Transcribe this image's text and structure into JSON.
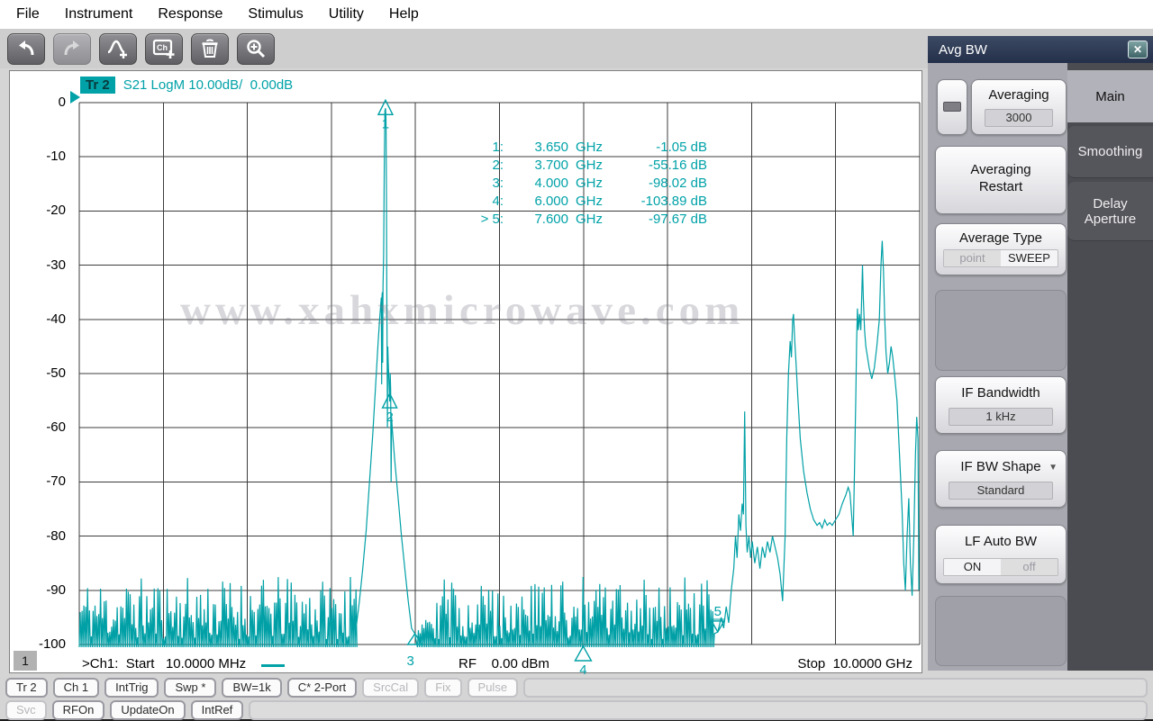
{
  "menu": {
    "items": [
      "File",
      "Instrument",
      "Response",
      "Stimulus",
      "Utility",
      "Help"
    ]
  },
  "toolbar": {
    "buttons": [
      {
        "icon": "undo-icon",
        "disabled": false
      },
      {
        "icon": "redo-icon",
        "disabled": true
      },
      {
        "icon": "add-trace-icon",
        "disabled": false
      },
      {
        "icon": "add-channel-icon",
        "disabled": false
      },
      {
        "icon": "delete-trash-icon",
        "disabled": false
      },
      {
        "icon": "zoom-in-icon",
        "disabled": false
      }
    ]
  },
  "plot": {
    "trace_badge": "Tr 2",
    "trace_title": "S21 LogM 10.00dB/  0.00dB",
    "channel_badge": "1",
    "start_label": ">Ch1:  Start   10.0000 MHz",
    "rf_label": "RF    0.00 dBm",
    "stop_label": "Stop  10.0000 GHz",
    "readout": [
      {
        "label": "1:",
        "freq": "3.650",
        "unit": "GHz",
        "value": "-1.05 dB"
      },
      {
        "label": "2:",
        "freq": "3.700",
        "unit": "GHz",
        "value": "-55.16 dB"
      },
      {
        "label": "3:",
        "freq": "4.000",
        "unit": "GHz",
        "value": "-98.02 dB"
      },
      {
        "label": "4:",
        "freq": "6.000",
        "unit": "GHz",
        "value": "-103.89 dB"
      },
      {
        "label": "> 5:",
        "freq": "7.600",
        "unit": "GHz",
        "value": "-97.67 dB"
      }
    ]
  },
  "chart_data": {
    "type": "line",
    "title": "S21 LogM 10.00dB/ 0.00dB",
    "trace_name": "Tr 2",
    "format": "Log magnitude, 10 dB/div, ref 0 dB",
    "x_unit": "GHz",
    "y_unit": "dB",
    "x_range": [
      0.01,
      10.0
    ],
    "ylim": [
      -100,
      0
    ],
    "x_divisions": 10,
    "y_ticks": [
      0,
      -10,
      -20,
      -30,
      -40,
      -50,
      -60,
      -70,
      -80,
      -90,
      -100
    ],
    "grid": true,
    "markers": [
      {
        "id": "1",
        "f": 3.65,
        "db": -1.05,
        "style": "up"
      },
      {
        "id": "2",
        "f": 3.7,
        "db": -55.16,
        "style": "up"
      },
      {
        "id": "3",
        "f": 4.0,
        "db": -98.02,
        "style": "pin-axis"
      },
      {
        "id": "4",
        "f": 6.0,
        "db": -103.89,
        "style": "pin-below"
      },
      {
        "id": "5",
        "f": 7.6,
        "db": -97.67,
        "style": "down-label-above"
      }
    ],
    "segments": [
      {
        "type": "noise",
        "from": 0.01,
        "to": 3.3,
        "step": 0.022,
        "floor": -100.8,
        "top_lo": -99,
        "top_hi": -87.5,
        "seed": 11
      },
      {
        "type": "points",
        "pts": [
          [
            3.3,
            -97
          ],
          [
            3.34,
            -92
          ],
          [
            3.38,
            -86
          ],
          [
            3.42,
            -79
          ],
          [
            3.46,
            -70
          ],
          [
            3.5,
            -61
          ],
          [
            3.53,
            -53
          ],
          [
            3.56,
            -45
          ],
          [
            3.58,
            -40
          ],
          [
            3.595,
            -37
          ],
          [
            3.6,
            -36
          ],
          [
            3.604,
            -52
          ],
          [
            3.608,
            -36
          ],
          [
            3.612,
            -35
          ],
          [
            3.616,
            -48
          ],
          [
            3.62,
            -34
          ],
          [
            3.628,
            -28
          ],
          [
            3.635,
            -12
          ],
          [
            3.643,
            -1.5
          ],
          [
            3.65,
            -1.05
          ],
          [
            3.656,
            -3
          ],
          [
            3.661,
            -16
          ],
          [
            3.665,
            -35
          ],
          [
            3.669,
            -44
          ],
          [
            3.673,
            -60
          ],
          [
            3.677,
            -45
          ],
          [
            3.683,
            -48
          ],
          [
            3.69,
            -51
          ],
          [
            3.7,
            -55.16
          ],
          [
            3.706,
            -50
          ],
          [
            3.712,
            -53
          ],
          [
            3.717,
            -70
          ],
          [
            3.722,
            -58
          ],
          [
            3.73,
            -60
          ],
          [
            3.76,
            -66
          ],
          [
            3.8,
            -73
          ],
          [
            3.84,
            -80
          ],
          [
            3.88,
            -86
          ],
          [
            3.92,
            -92
          ],
          [
            3.96,
            -97
          ],
          [
            4.0,
            -98.02
          ]
        ]
      },
      {
        "type": "noise",
        "from": 4.03,
        "to": 7.55,
        "step": 0.022,
        "floor": -100.8,
        "top_lo": -99,
        "top_hi": -87.5,
        "seed": 29
      },
      {
        "type": "points",
        "pts": [
          [
            7.56,
            -98
          ],
          [
            7.6,
            -97.67
          ],
          [
            7.64,
            -95
          ],
          [
            7.67,
            -97
          ],
          [
            7.7,
            -93
          ],
          [
            7.73,
            -96
          ],
          [
            7.76,
            -90
          ],
          [
            7.79,
            -86
          ],
          [
            7.81,
            -80
          ],
          [
            7.83,
            -84
          ],
          [
            7.85,
            -76
          ],
          [
            7.87,
            -79
          ],
          [
            7.89,
            -74
          ],
          [
            7.905,
            -76
          ],
          [
            7.92,
            -57
          ],
          [
            7.935,
            -78
          ],
          [
            7.95,
            -83
          ],
          [
            7.97,
            -80
          ],
          [
            7.99,
            -84
          ],
          [
            8.01,
            -81
          ],
          [
            8.04,
            -85
          ],
          [
            8.07,
            -82
          ],
          [
            8.1,
            -86
          ],
          [
            8.13,
            -82
          ],
          [
            8.16,
            -84
          ],
          [
            8.19,
            -81
          ],
          [
            8.22,
            -83
          ],
          [
            8.25,
            -80
          ],
          [
            8.28,
            -82
          ],
          [
            8.31,
            -84
          ],
          [
            8.34,
            -87
          ],
          [
            8.37,
            -92
          ],
          [
            8.4,
            -80
          ],
          [
            8.42,
            -62
          ],
          [
            8.44,
            -50
          ],
          [
            8.46,
            -44
          ],
          [
            8.475,
            -47
          ],
          [
            8.49,
            -40
          ],
          [
            8.5,
            -39
          ],
          [
            8.515,
            -44
          ],
          [
            8.53,
            -48
          ],
          [
            8.55,
            -54
          ],
          [
            8.58,
            -62
          ],
          [
            8.62,
            -68
          ],
          [
            8.66,
            -72
          ],
          [
            8.7,
            -75
          ],
          [
            8.74,
            -77
          ],
          [
            8.78,
            -78
          ],
          [
            8.81,
            -77.5
          ],
          [
            8.84,
            -78.5
          ],
          [
            8.87,
            -77
          ],
          [
            8.9,
            -78
          ],
          [
            8.93,
            -77.5
          ],
          [
            8.96,
            -78
          ],
          [
            9.0,
            -77
          ],
          [
            9.04,
            -76
          ],
          [
            9.08,
            -74
          ],
          [
            9.12,
            -72.5
          ],
          [
            9.15,
            -71
          ],
          [
            9.17,
            -72
          ],
          [
            9.19,
            -76
          ],
          [
            9.21,
            -80
          ],
          [
            9.225,
            -68
          ],
          [
            9.24,
            -55
          ],
          [
            9.25,
            -44
          ],
          [
            9.26,
            -38
          ],
          [
            9.27,
            -42
          ],
          [
            9.285,
            -39
          ],
          [
            9.3,
            -42
          ],
          [
            9.31,
            -36
          ],
          [
            9.32,
            -30
          ],
          [
            9.33,
            -36
          ],
          [
            9.345,
            -42
          ],
          [
            9.36,
            -45
          ],
          [
            9.38,
            -47
          ],
          [
            9.4,
            -49
          ],
          [
            9.43,
            -51
          ],
          [
            9.46,
            -49
          ],
          [
            9.49,
            -45
          ],
          [
            9.52,
            -40
          ],
          [
            9.54,
            -30
          ],
          [
            9.555,
            -25.5
          ],
          [
            9.57,
            -31
          ],
          [
            9.585,
            -40
          ],
          [
            9.6,
            -46
          ],
          [
            9.62,
            -50
          ],
          [
            9.64,
            -48
          ],
          [
            9.66,
            -45
          ],
          [
            9.68,
            -47
          ],
          [
            9.7,
            -50
          ],
          [
            9.73,
            -55
          ],
          [
            9.76,
            -65
          ],
          [
            9.79,
            -75
          ],
          [
            9.81,
            -85
          ],
          [
            9.83,
            -90
          ],
          [
            9.85,
            -80
          ],
          [
            9.87,
            -73
          ],
          [
            9.89,
            -85
          ],
          [
            9.91,
            -91
          ],
          [
            9.93,
            -80
          ],
          [
            9.95,
            -65
          ],
          [
            9.965,
            -58
          ],
          [
            9.98,
            -62
          ],
          [
            9.99,
            -90
          ]
        ]
      }
    ]
  },
  "panel": {
    "title": "Avg BW",
    "icons": {
      "close": "✕",
      "dropdown": "▼"
    },
    "buttons": {
      "averaging": {
        "label": "Averaging",
        "value": "3000"
      },
      "averaging_restart": {
        "label": "Averaging Restart"
      },
      "average_type": {
        "label": "Average Type",
        "options": [
          "point",
          "SWEEP"
        ],
        "selected": "SWEEP"
      },
      "if_bandwidth": {
        "label": "IF Bandwidth",
        "value": "1 kHz"
      },
      "if_bw_shape": {
        "label": "IF BW Shape",
        "value": "Standard"
      },
      "lf_auto_bw": {
        "label": "LF Auto BW",
        "options": [
          "ON",
          "off"
        ],
        "selected": "ON"
      }
    },
    "tabs": [
      {
        "label": "Main",
        "active": true
      },
      {
        "label": "Smoothing",
        "active": false
      },
      {
        "label": "Delay Aperture",
        "active": false
      }
    ]
  },
  "status_bar": {
    "row1": [
      {
        "label": "Tr 2",
        "enabled": true
      },
      {
        "label": "Ch 1",
        "enabled": true
      },
      {
        "label": "IntTrig",
        "enabled": true
      },
      {
        "label": "Swp *",
        "enabled": true
      },
      {
        "label": "BW=1k",
        "enabled": true
      },
      {
        "label": "C* 2-Port",
        "enabled": true
      },
      {
        "label": "SrcCal",
        "enabled": false
      },
      {
        "label": "Fix",
        "enabled": false
      },
      {
        "label": "Pulse",
        "enabled": false
      }
    ],
    "row2": [
      {
        "label": "Svc",
        "enabled": false
      },
      {
        "label": "RFOn",
        "enabled": true
      },
      {
        "label": "UpdateOn",
        "enabled": true
      },
      {
        "label": "IntRef",
        "enabled": true
      }
    ]
  },
  "watermark": "www.xahxmicrowave.com",
  "colors": {
    "accent_teal": "#00a2a8",
    "trace": "#00a0a6",
    "grid": "#3c3c3c",
    "panel_titlebar": "#2a3650",
    "panel_body": "#a8a8b0",
    "tab_dark": "#55555c"
  }
}
